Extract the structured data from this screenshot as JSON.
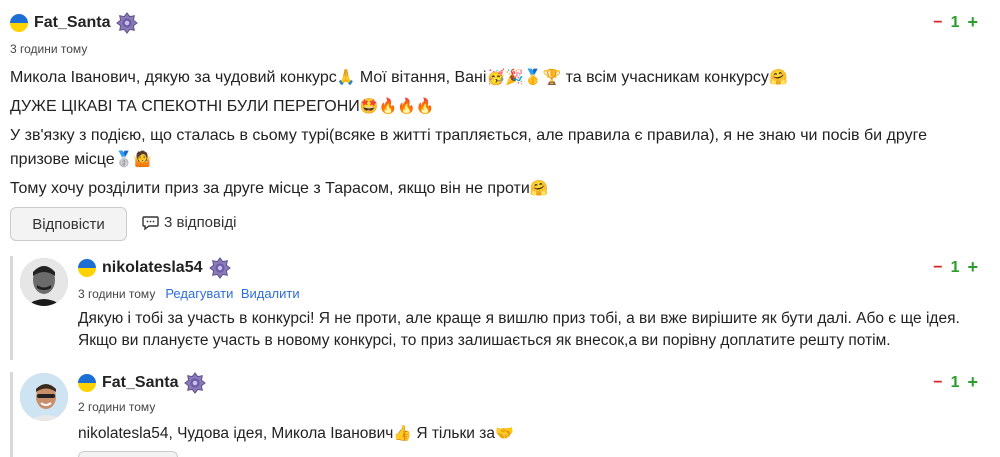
{
  "comment1": {
    "username": "Fat_Santa",
    "time": "3 години тому",
    "vote": {
      "minus": "−",
      "score": "1",
      "plus": "+"
    },
    "lines": [
      {
        "text": "Микола Іванович, дякую за чудовий конкурс",
        "emoji": "🙏",
        "text2": " Мої вітання, Вані",
        "emoji2": "🥳🎉🥇🏆",
        "text3": " та всім учасникам конкурсу",
        "emoji3": "🤗"
      },
      {
        "text": "ДУЖЕ ЦІКАВІ ТА СПЕКОТНІ БУЛИ ПЕРЕГОНИ",
        "emoji": "🤩🔥🔥🔥"
      },
      {
        "text": "У зв'язку з подією, що сталась в сьому турі(всяке в житті трапляється, але правила є правила), я не знаю чи посів би друге призове місце",
        "emoji": "🥈🤷"
      },
      {
        "text": "Тому хочу розділити приз за друге місце з Тарасом, якщо він не проти",
        "emoji": "🤗"
      }
    ],
    "reply_label": "Відповісти",
    "replies_count": "3 відповіді"
  },
  "comment2": {
    "username": "nikolatesla54",
    "time": "3 години тому",
    "edit_label": "Редагувати",
    "delete_label": "Видалити",
    "vote": {
      "minus": "−",
      "score": "1",
      "plus": "+"
    },
    "text": "Дякую і тобі за участь в конкурсі! Я не проти, але краще я вишлю приз тобі, а ви вже вирішите як бути далі. Або є ще ідея. Якщо ви плануєте участь в новому конкурсі, то приз залишається як внесок,а ви порівну доплатите решту потім."
  },
  "comment3": {
    "username": "Fat_Santa",
    "time": "2 години тому",
    "vote": {
      "minus": "−",
      "score": "1",
      "plus": "+"
    },
    "mention": "nikolatesla54",
    "text": ", Чудова ідея, Микола Іванович",
    "emoji": "👍",
    "text2": " Я тільки за",
    "emoji2": "🤝"
  },
  "icons": {
    "flag": "ukraine-flag-icon",
    "badge": "rank-badge-icon",
    "speech": "speech-bubble-icon"
  },
  "colors": {
    "minus": "#d62828",
    "plus": "#2a9d2a",
    "link": "#2f6fd6",
    "flag_blue": "#1c6ed2",
    "flag_yellow": "#ffd200"
  }
}
